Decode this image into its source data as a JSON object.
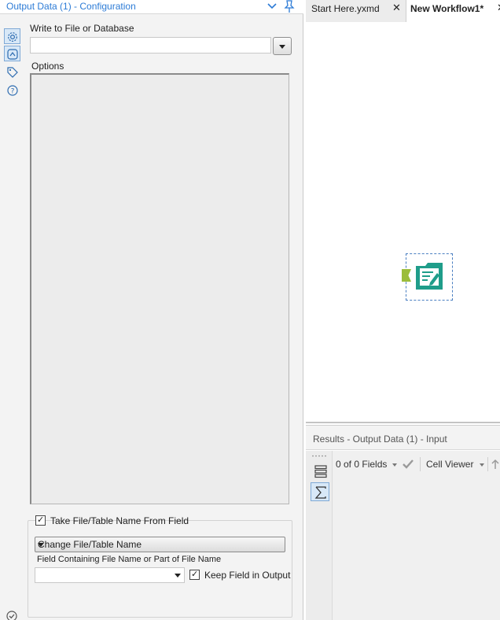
{
  "config": {
    "title": "Output Data (1) - Configuration",
    "write_label": "Write to File or Database",
    "write_value": "",
    "options_label": "Options",
    "take_name_label": "Take File/Table Name From Field",
    "take_name_checked": true,
    "name_mode_value": "Change File/Table Name",
    "field_label": "Field Containing File Name or Part of File Name",
    "field_value": "",
    "keep_field_label": "Keep Field in Output",
    "keep_field_checked": true
  },
  "icons": {
    "rail": [
      "gear-icon",
      "connection-icon",
      "tag-icon",
      "help-icon"
    ],
    "header": [
      "chevron-down-icon",
      "pin-icon"
    ]
  },
  "tabs": [
    {
      "label": "Start Here.yxmd",
      "active": false,
      "close": "✕"
    },
    {
      "label": "New Workflow1*",
      "active": true,
      "close": "✕"
    }
  ],
  "results": {
    "title": "Results - Output Data (1) - Input",
    "fields_label": "0 of 0 Fields",
    "cell_viewer_label": "Cell Viewer"
  },
  "colors": {
    "accent": "#2c7bd6",
    "tool_teal": "#1f9d8a",
    "anchor_green": "#9bbd3b",
    "selected_bg": "#d8e8f7"
  }
}
